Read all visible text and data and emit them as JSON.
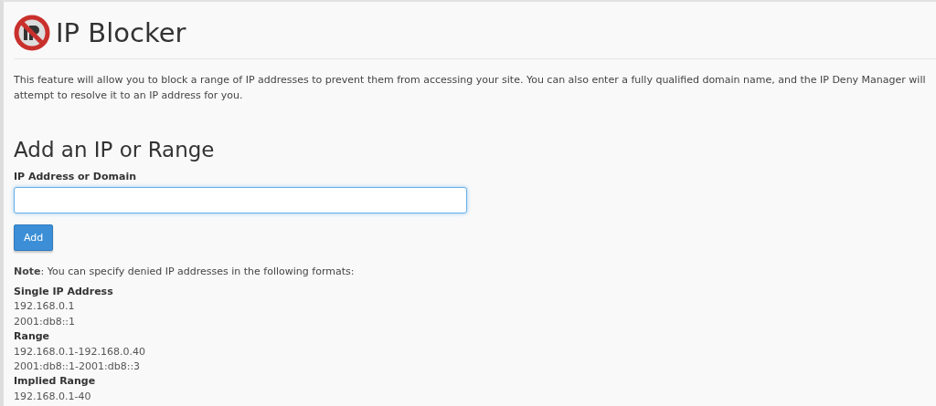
{
  "header": {
    "title": "IP Blocker"
  },
  "description": "This feature will allow you to block a range of IP addresses to prevent them from accessing your site. You can also enter a fully qualified domain name, and the IP Deny Manager will attempt to resolve it to an IP address for you.",
  "form": {
    "heading": "Add an IP or Range",
    "field_label": "IP Address or Domain",
    "field_focused": true,
    "button": "Add"
  },
  "note": "**Note**: You can specify denied IP addresses in the following formats:",
  "formats": [
    {
      "kind": "heading",
      "text": "Single IP Address"
    },
    {
      "kind": "example",
      "text": "192.168.0.1"
    },
    {
      "kind": "example",
      "text": "2001:db8::1"
    },
    {
      "kind": "heading",
      "text": "Range"
    },
    {
      "kind": "example",
      "text": "192.168.0.1-192.168.0.40"
    },
    {
      "kind": "example",
      "text": "2001:db8::1-2001:db8::3"
    },
    {
      "kind": "heading",
      "text": "Implied Range"
    },
    {
      "kind": "example",
      "text": "192.168.0.1-40"
    }
  ]
}
